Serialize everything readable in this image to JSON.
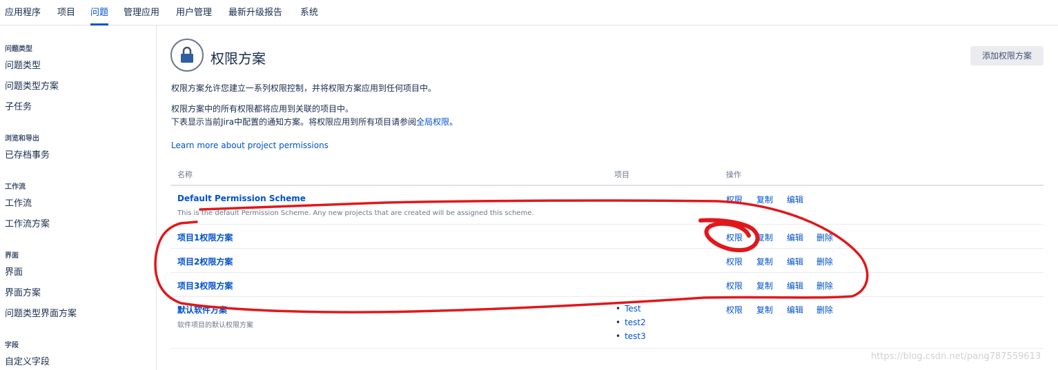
{
  "nav": {
    "tabs": [
      "应用程序",
      "项目",
      "问题",
      "管理应用",
      "用户管理",
      "最新升级报告",
      "系统"
    ],
    "active_index": 2
  },
  "sidebar": {
    "sections": [
      {
        "heading": "问题类型",
        "items": [
          "问题类型",
          "问题类型方案",
          "子任务"
        ]
      },
      {
        "heading": "浏览和导出",
        "items": [
          "已存档事务"
        ]
      },
      {
        "heading": "工作流",
        "items": [
          "工作流",
          "工作流方案"
        ]
      },
      {
        "heading": "界面",
        "items": [
          "界面",
          "界面方案",
          "问题类型界面方案"
        ]
      },
      {
        "heading": "字段",
        "items": [
          "自定义字段"
        ]
      }
    ]
  },
  "page": {
    "title": "权限方案",
    "add_button": "添加权限方案",
    "desc1": "权限方案允许您建立一系列权限控制，并将权限方案应用到任何项目中。",
    "desc2": "权限方案中的所有权限都将应用到关联的项目中。",
    "desc3_prefix": "下表显示当前Jira中配置的通知方案。将权限应用到所有项目请参阅",
    "desc3_link": "全局权限",
    "desc3_suffix": "。",
    "learn_more": "Learn more about project permissions"
  },
  "table": {
    "headers": {
      "name": "名称",
      "projects": "项目",
      "operations": "操作"
    },
    "op_labels": {
      "permissions": "权限",
      "copy": "复制",
      "edit": "编辑",
      "delete": "删除"
    },
    "rows": [
      {
        "name": "Default Permission Scheme",
        "description": "This is the default Permission Scheme. Any new projects that are created will be assigned this scheme.",
        "projects": [],
        "deletable": false
      },
      {
        "name": "项目1权限方案",
        "description": "",
        "projects": [],
        "deletable": true
      },
      {
        "name": "项目2权限方案",
        "description": "",
        "projects": [],
        "deletable": true
      },
      {
        "name": "项目3权限方案",
        "description": "",
        "projects": [],
        "deletable": true
      },
      {
        "name": "默认软件方案",
        "description": "软件项目的默认权限方案",
        "projects": [
          "Test",
          "test2",
          "test3"
        ],
        "deletable": true
      }
    ]
  },
  "watermark": "https://blog.csdn.net/pang787559613",
  "colors": {
    "link": "#0052cc",
    "annotation": "#e0181b"
  }
}
